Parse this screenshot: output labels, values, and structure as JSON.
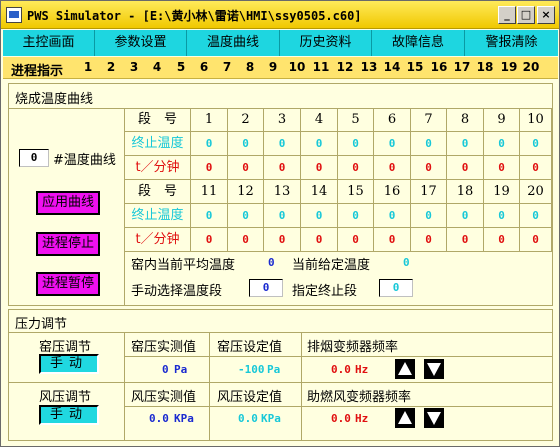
{
  "window": {
    "title": "PWS Simulator - [E:\\黄小林\\雷诺\\HMI\\ssy0505.c60]",
    "min": "_",
    "max": "□",
    "close": "×"
  },
  "menu": [
    "主控画面",
    "参数设置",
    "温度曲线",
    "历史资料",
    "故障信息",
    "警报清除"
  ],
  "steps": {
    "label": "进程指示",
    "numbers": [
      "1",
      "2",
      "3",
      "4",
      "5",
      "6",
      "7",
      "8",
      "9",
      "10",
      "11",
      "12",
      "13",
      "14",
      "15",
      "16",
      "17",
      "18",
      "19",
      "20"
    ]
  },
  "firing": {
    "title": "烧成温度曲线",
    "curve_value": "0",
    "curve_label": "#温度曲线",
    "btn_apply": "应用曲线",
    "btn_stop": "进程停止",
    "btn_pause": "进程暂停",
    "row_seg": "段　号",
    "row_temp": "终止温度",
    "row_rate": "t／分钟",
    "segs1": [
      "1",
      "2",
      "3",
      "4",
      "5",
      "6",
      "7",
      "8",
      "9",
      "10"
    ],
    "segs2": [
      "11",
      "12",
      "13",
      "14",
      "15",
      "16",
      "17",
      "18",
      "19",
      "20"
    ],
    "temps1": [
      "0",
      "0",
      "0",
      "0",
      "0",
      "0",
      "0",
      "0",
      "0",
      "0"
    ],
    "rates1": [
      "0",
      "0",
      "0",
      "0",
      "0",
      "0",
      "0",
      "0",
      "0",
      "0"
    ],
    "temps2": [
      "0",
      "0",
      "0",
      "0",
      "0",
      "0",
      "0",
      "0",
      "0",
      "0"
    ],
    "rates2": [
      "0",
      "0",
      "0",
      "0",
      "0",
      "0",
      "0",
      "0",
      "0",
      "0"
    ],
    "avg_temp_label": "窑内当前平均温度",
    "avg_temp_value": "0",
    "set_temp_label": "当前给定温度",
    "set_temp_value": "0",
    "manual_seg_label": "手动选择温度段",
    "manual_seg_value": "0",
    "end_seg_label": "指定终止段",
    "end_seg_value": "0"
  },
  "pressure": {
    "title": "压力调节",
    "kiln_label": "窑压调节",
    "kiln_mode": "手动",
    "kiln_actual_label": "窑压实测值",
    "kiln_actual_value": "0",
    "kiln_actual_unit": "Pa",
    "kiln_set_label": "窑压设定值",
    "kiln_set_value": "-100",
    "kiln_set_unit": "Pa",
    "exhaust_label": "排烟变频器频率",
    "exhaust_value": "0.0",
    "exhaust_unit": "Hz",
    "wind_label": "风压调节",
    "wind_mode": "手动",
    "wind_actual_label": "风压实测值",
    "wind_actual_value": "0.0",
    "wind_actual_unit": "KPa",
    "wind_set_label": "风压设定值",
    "wind_set_value": "0.0",
    "wind_set_unit": "KPa",
    "blower_label": "助燃风变频器频率",
    "blower_value": "0.0",
    "blower_unit": "Hz"
  }
}
